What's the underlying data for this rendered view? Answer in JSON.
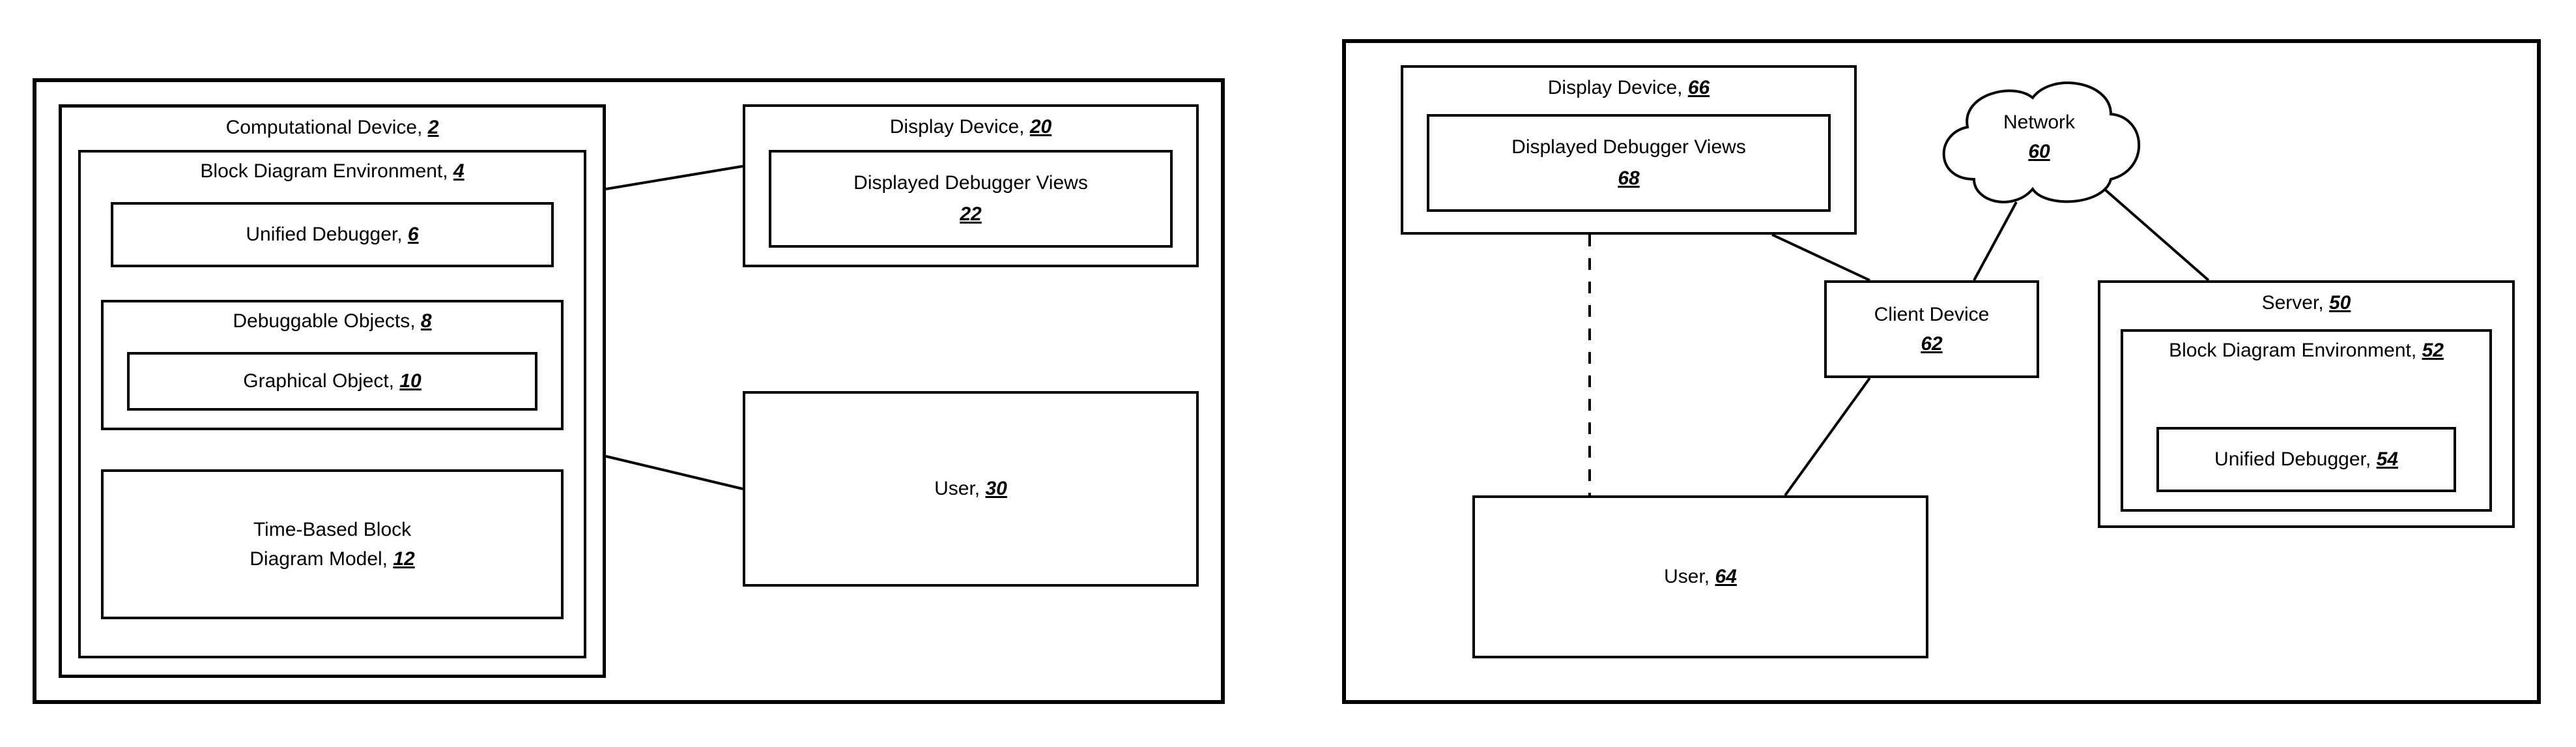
{
  "left": {
    "comp_device": {
      "label": "Computational Device,",
      "ref": "2"
    },
    "bde": {
      "label": "Block Diagram Environment,",
      "ref": "4"
    },
    "unified_debugger": {
      "label": "Unified Debugger,",
      "ref": "6"
    },
    "debuggable_objects": {
      "label": "Debuggable Objects,",
      "ref": "8"
    },
    "graphical_object": {
      "label": "Graphical Object,",
      "ref": "10"
    },
    "tbbdm": {
      "label1": "Time-Based Block",
      "label2": "Diagram Model,",
      "ref": "12"
    },
    "display_device": {
      "label": "Display Device,",
      "ref": "20"
    },
    "displayed_views": {
      "label": "Displayed Debugger Views",
      "ref": "22"
    },
    "user": {
      "label": "User,",
      "ref": "30"
    }
  },
  "right": {
    "display_device": {
      "label": "Display Device,",
      "ref": "66"
    },
    "displayed_views": {
      "label": "Displayed Debugger Views",
      "ref": "68"
    },
    "network": {
      "label": "Network",
      "ref": "60"
    },
    "client_device": {
      "label": "Client Device",
      "ref": "62"
    },
    "user": {
      "label": "User,",
      "ref": "64"
    },
    "server": {
      "label": "Server,",
      "ref": "50"
    },
    "bde": {
      "label": "Block Diagram Environment,",
      "ref": "52"
    },
    "unified_debugger": {
      "label": "Unified Debugger,",
      "ref": "54"
    }
  }
}
